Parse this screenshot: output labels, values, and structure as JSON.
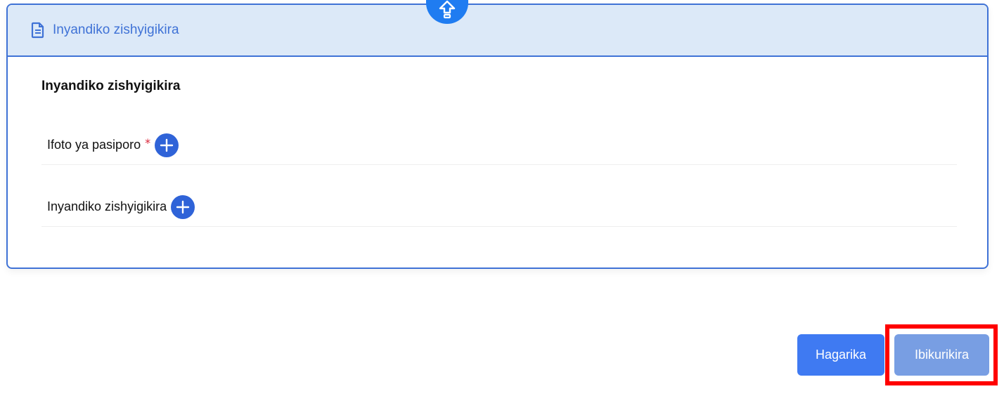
{
  "card": {
    "header_title": "Inyandiko zishyigikira",
    "section_title": "Inyandiko zishyigikira",
    "rows": [
      {
        "label": "Ifoto ya pasiporo",
        "required_marker": "*"
      },
      {
        "label": "Inyandiko zishyigikira"
      }
    ]
  },
  "actions": {
    "cancel_label": "Hagarika",
    "submit_label": "Ibikurikira"
  },
  "icons": {
    "header": "document-icon",
    "top_tab": "upload-icon",
    "add": "plus-circle-icon"
  },
  "colors": {
    "accent": "#3f72d6",
    "header_bg": "#dce9f8",
    "add_button": "#2f63d8",
    "cancel_button": "#3f7af2",
    "submit_button": "#789ee3",
    "required": "#d9263a",
    "highlight": "#ff0000"
  }
}
